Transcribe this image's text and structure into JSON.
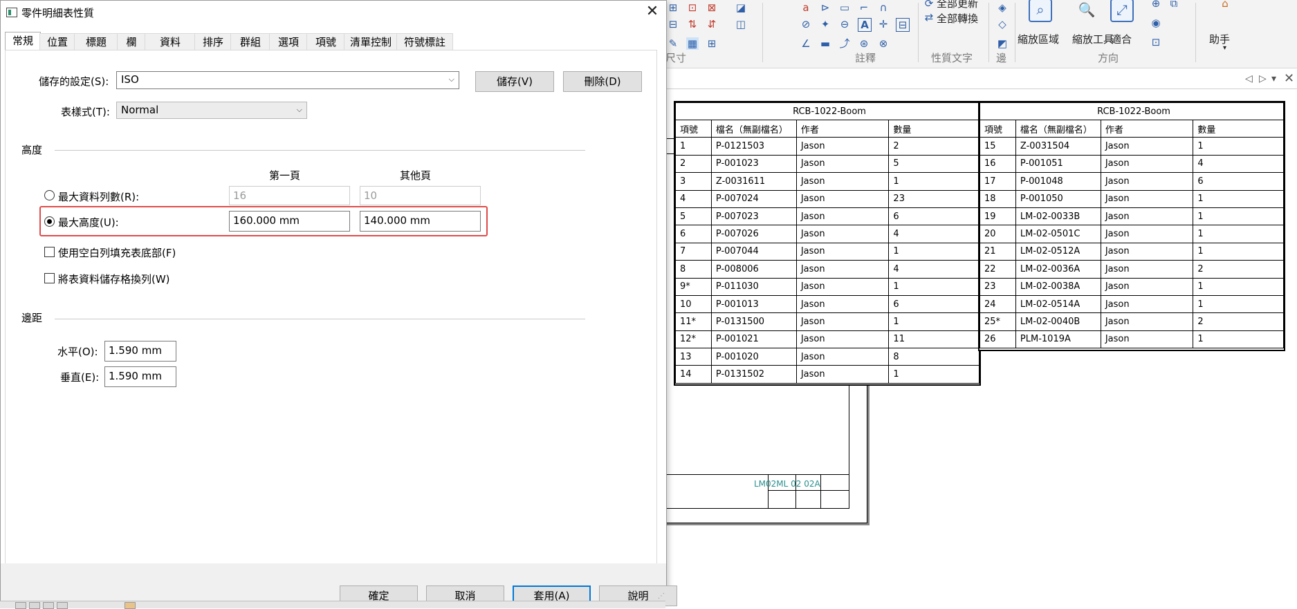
{
  "dialog": {
    "title": "零件明細表性質",
    "close_icon": "close-icon",
    "tabs": [
      "常規",
      "位置",
      "標題",
      "欄",
      "資料",
      "排序",
      "群組",
      "選項",
      "項號",
      "清單控制",
      "符號標註"
    ],
    "active_tab": "常規",
    "saved_settings_label": "儲存的設定(S):",
    "saved_settings_value": "ISO",
    "save_button": "儲存(V)",
    "delete_button": "刪除(D)",
    "table_style_label": "表樣式(T):",
    "table_style_value": "Normal",
    "height_section": "高度",
    "first_page_header": "第一頁",
    "other_pages_header": "其他頁",
    "max_rows_label": "最大資料列數(R):",
    "max_rows_first": "16",
    "max_rows_other": "10",
    "max_height_label": "最大高度(U):",
    "max_height_first": "160.000 mm",
    "max_height_other": "140.000 mm",
    "height_mode_selected": "max_height",
    "fill_blank_rows_label": "使用空白列填充表底部(F)",
    "fill_blank_rows_checked": false,
    "wrap_rows_label": "將表資料儲存格換列(W)",
    "wrap_rows_checked": false,
    "margin_section": "邊距",
    "horizontal_label": "水平(O):",
    "horizontal_value": "1.590 mm",
    "vertical_label": "垂直(E):",
    "vertical_value": "1.590 mm",
    "ok_button": "確定",
    "cancel_button": "取消",
    "apply_button": "套用(A)",
    "help_button": "說明",
    "highlight_color": "#e04a4a",
    "accent_color": "#0078d7"
  },
  "ribbon": {
    "labels": [
      "全部更新",
      "全部轉換",
      "縮放區域",
      "縮放工具",
      "適合",
      "助手"
    ],
    "groups": [
      "尺寸",
      "註釋",
      "性質文字",
      "邊",
      "方向"
    ]
  },
  "bom_tables": [
    {
      "title": "RCB-1022-Boom",
      "headers": [
        "項號",
        "檔名（無副檔名）",
        "作者",
        "數量"
      ],
      "rows": [
        [
          "1",
          "P-0121503",
          "Jason",
          "2"
        ],
        [
          "2",
          "P-001023",
          "Jason",
          "5"
        ],
        [
          "3",
          "Z-0031611",
          "Jason",
          "1"
        ],
        [
          "4",
          "P-007024",
          "Jason",
          "23"
        ],
        [
          "5",
          "P-007023",
          "Jason",
          "6"
        ],
        [
          "6",
          "P-007026",
          "Jason",
          "4"
        ],
        [
          "7",
          "P-007044",
          "Jason",
          "1"
        ],
        [
          "8",
          "P-008006",
          "Jason",
          "4"
        ],
        [
          "9*",
          "P-011030",
          "Jason",
          "1"
        ],
        [
          "10",
          "P-001013",
          "Jason",
          "6"
        ],
        [
          "11*",
          "P-0131500",
          "Jason",
          "1"
        ],
        [
          "12*",
          "P-001021",
          "Jason",
          "11"
        ],
        [
          "13",
          "P-001020",
          "Jason",
          "8"
        ],
        [
          "14",
          "P-0131502",
          "Jason",
          "1"
        ]
      ]
    },
    {
      "title": "RCB-1022-Boom",
      "headers": [
        "項號",
        "檔名（無副檔名）",
        "作者",
        "數量"
      ],
      "rows": [
        [
          "15",
          "Z-0031504",
          "Jason",
          "1"
        ],
        [
          "16",
          "P-001051",
          "Jason",
          "4"
        ],
        [
          "17",
          "P-001048",
          "Jason",
          "6"
        ],
        [
          "18",
          "P-001050",
          "Jason",
          "1"
        ],
        [
          "19",
          "LM-02-0033B",
          "Jason",
          "1"
        ],
        [
          "20",
          "LM-02-0501C",
          "Jason",
          "1"
        ],
        [
          "21",
          "LM-02-0512A",
          "Jason",
          "1"
        ],
        [
          "22",
          "LM-02-0036A",
          "Jason",
          "2"
        ],
        [
          "23",
          "LM-02-0038A",
          "Jason",
          "1"
        ],
        [
          "24",
          "LM-02-0514A",
          "Jason",
          "1"
        ],
        [
          "25*",
          "LM-02-0040B",
          "Jason",
          "2"
        ],
        [
          "26",
          "PLM-1019A",
          "Jason",
          "1"
        ]
      ]
    }
  ],
  "title_block": {
    "teal_text": "LM02ML 02 02A"
  }
}
